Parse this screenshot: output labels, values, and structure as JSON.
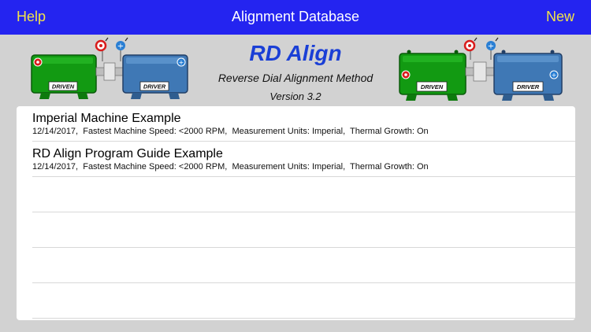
{
  "nav": {
    "help_label": "Help",
    "title": "Alignment Database",
    "new_label": "New"
  },
  "header": {
    "app_name": "RD Align",
    "subtitle": "Reverse Dial Alignment Method",
    "version": "Version 3.2",
    "left_illustration": {
      "driven_label": "DRIVEN",
      "driver_label": "DRIVER"
    },
    "right_illustration": {
      "driven_label": "DRIVEN",
      "driver_label": "DRIVER"
    }
  },
  "colors": {
    "nav_bar": "#2424f0",
    "nav_button_text": "#f2e34a",
    "app_title": "#1a3fd6",
    "driven_machine": "#129a12",
    "driver_machine": "#3f78b5",
    "background": "#d2d2d2"
  },
  "icons": [
    "red-target-icon",
    "blue-plus-icon"
  ],
  "list": {
    "rows": [
      {
        "title": "Imperial Machine Example",
        "detail": "12/14/2017,  Fastest Machine Speed: <2000 RPM,  Measurement Units: Imperial,  Thermal Growth: On"
      },
      {
        "title": "RD Align Program Guide Example",
        "detail": "12/14/2017,  Fastest Machine Speed: <2000 RPM,  Measurement Units: Imperial,  Thermal Growth: On"
      },
      {
        "title": "",
        "detail": ""
      },
      {
        "title": "",
        "detail": ""
      },
      {
        "title": "",
        "detail": ""
      },
      {
        "title": "",
        "detail": ""
      }
    ]
  }
}
